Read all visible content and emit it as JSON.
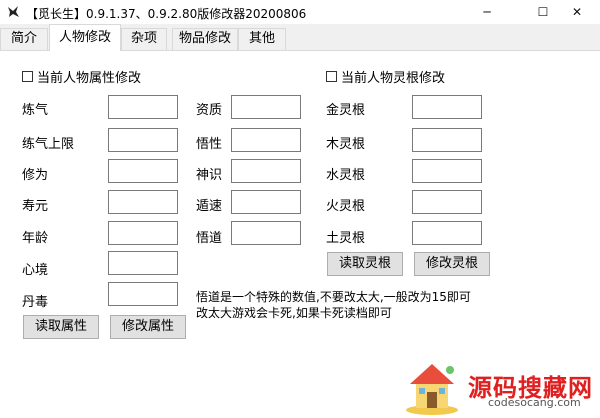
{
  "window": {
    "title": "【觅长生】0.9.1.37、0.9.2.80版修改器20200806",
    "controls": {
      "minimize": "─",
      "maximize": "☐",
      "close": "✕"
    }
  },
  "tabs": [
    {
      "label": "简介",
      "active": false
    },
    {
      "label": "人物修改",
      "active": true
    },
    {
      "label": "杂项",
      "active": false
    },
    {
      "label": "物品修改",
      "active": false
    },
    {
      "label": "其他",
      "active": false
    }
  ],
  "attributes": {
    "checkbox_label": "当前人物属性修改",
    "left_fields": [
      {
        "label": "炼气",
        "value": ""
      },
      {
        "label": "练气上限",
        "value": ""
      },
      {
        "label": "修为",
        "value": ""
      },
      {
        "label": "寿元",
        "value": ""
      },
      {
        "label": "年龄",
        "value": ""
      },
      {
        "label": "心境",
        "value": ""
      },
      {
        "label": "丹毒",
        "value": ""
      }
    ],
    "mid_fields": [
      {
        "label": "资质",
        "value": ""
      },
      {
        "label": "悟性",
        "value": ""
      },
      {
        "label": "神识",
        "value": ""
      },
      {
        "label": "遁速",
        "value": ""
      },
      {
        "label": "悟道",
        "value": ""
      }
    ],
    "read_button": "读取属性",
    "modify_button": "修改属性"
  },
  "spirit_roots": {
    "checkbox_label": "当前人物灵根修改",
    "fields": [
      {
        "label": "金灵根",
        "value": ""
      },
      {
        "label": "木灵根",
        "value": ""
      },
      {
        "label": "水灵根",
        "value": ""
      },
      {
        "label": "火灵根",
        "value": ""
      },
      {
        "label": "土灵根",
        "value": ""
      }
    ],
    "read_button": "读取灵根",
    "modify_button": "修改灵根"
  },
  "note": {
    "line1": "悟道是一个特殊的数值,不要改太大,一般改为15即可",
    "line2": "改太大游戏会卡死,如果卡死读档即可"
  },
  "watermark": {
    "text": "源码搜藏网",
    "url": "codesocang.com",
    "color": "#e02020"
  }
}
